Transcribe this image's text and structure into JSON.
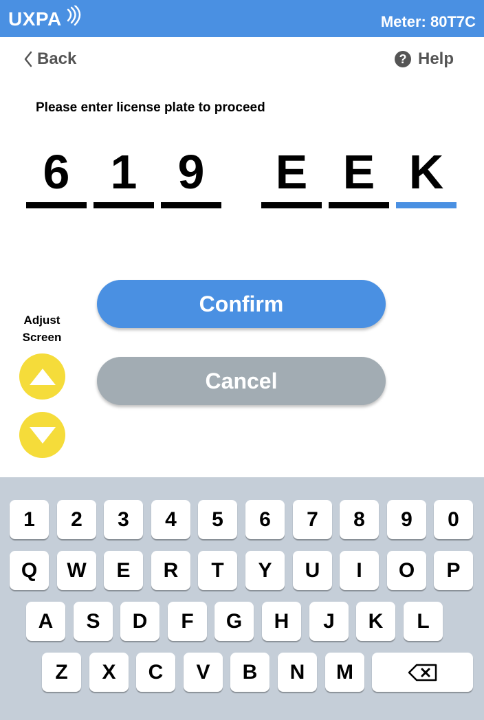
{
  "header": {
    "logo_text": "UXPA",
    "meter_text": "Meter: 80T7C",
    "bar_color": "#4a90e2"
  },
  "nav": {
    "back_label": "Back",
    "help_label": "Help",
    "help_icon": "question-circle-icon"
  },
  "prompt": "Please enter license plate to proceed",
  "plate": {
    "characters": [
      "6",
      "1",
      "9",
      "E",
      "E",
      "K"
    ],
    "active_index": 5,
    "active_color": "#4a90e2"
  },
  "actions": {
    "confirm_label": "Confirm",
    "cancel_label": "Cancel",
    "confirm_color": "#4a90e2",
    "cancel_color": "#a2acb3"
  },
  "adjust": {
    "label_line1": "Adjust",
    "label_line2": "Screen",
    "button_color": "#f5dc3a"
  },
  "keyboard": {
    "row1": [
      "1",
      "2",
      "3",
      "4",
      "5",
      "6",
      "7",
      "8",
      "9",
      "0"
    ],
    "row2": [
      "Q",
      "W",
      "E",
      "R",
      "T",
      "Y",
      "U",
      "I",
      "O",
      "P"
    ],
    "row3": [
      "A",
      "S",
      "D",
      "F",
      "G",
      "H",
      "J",
      "K",
      "L"
    ],
    "row4": [
      "Z",
      "X",
      "C",
      "V",
      "B",
      "N",
      "M"
    ],
    "backspace_icon": "backspace-icon",
    "background_color": "#c5ced8"
  }
}
